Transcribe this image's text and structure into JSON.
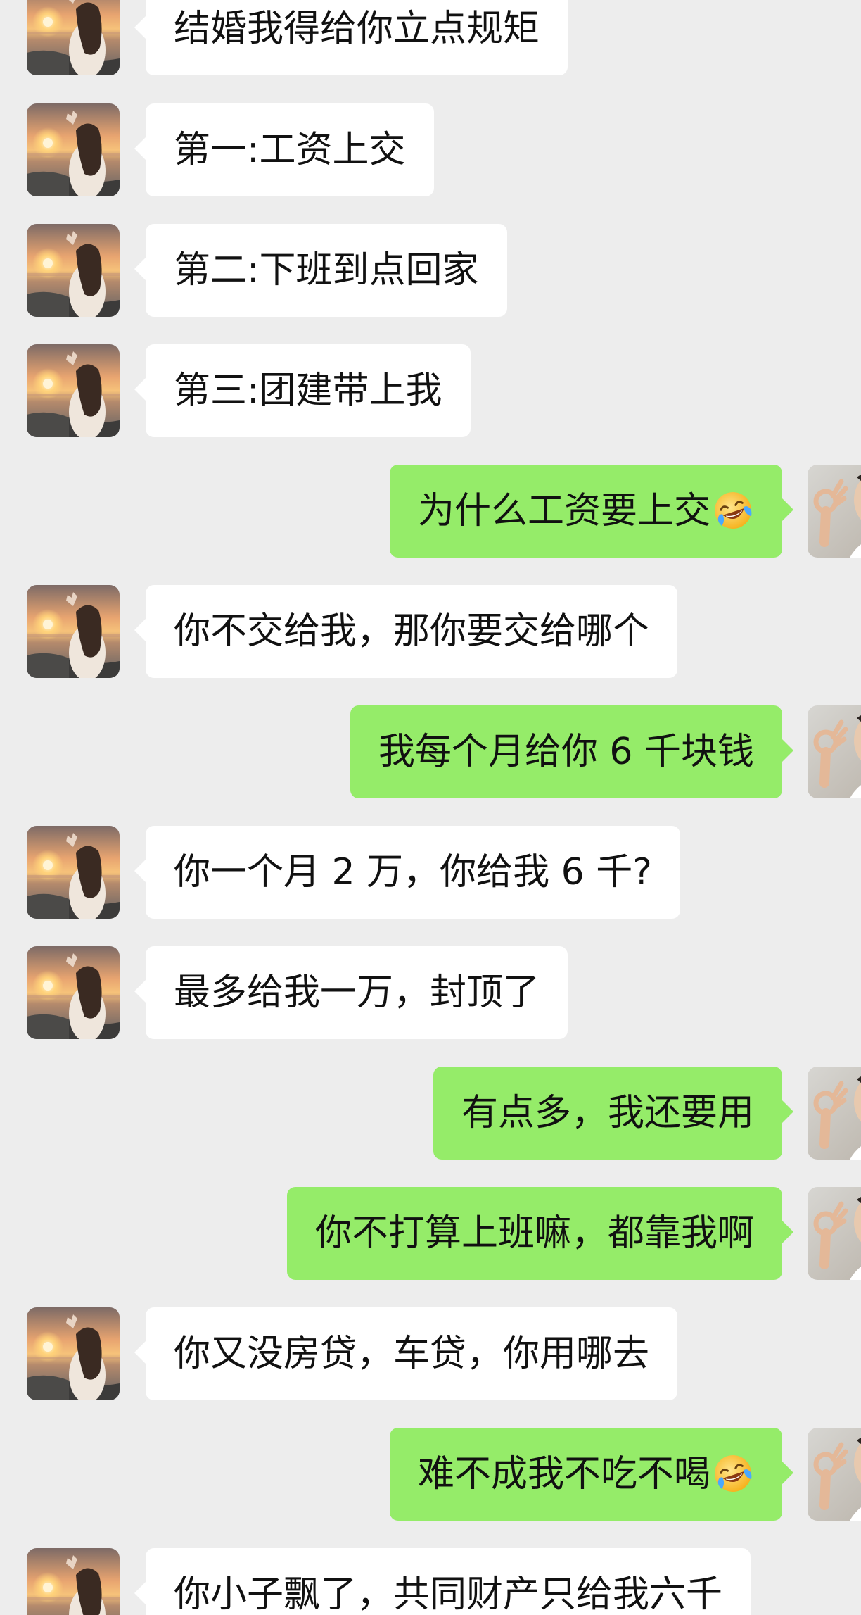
{
  "conversation": {
    "messages": [
      {
        "side": "in",
        "text": "结婚我得给你立点规矩"
      },
      {
        "side": "in",
        "text": "第一:工资上交"
      },
      {
        "side": "in",
        "text": "第二:下班到点回家"
      },
      {
        "side": "in",
        "text": "第三:团建带上我"
      },
      {
        "side": "out",
        "text": "为什么工资要上交",
        "emoji": "laughing-crying-emoji"
      },
      {
        "side": "in",
        "text": "你不交给我，那你要交给哪个"
      },
      {
        "side": "out",
        "text": "我每个月给你 6 千块钱"
      },
      {
        "side": "in",
        "text": "你一个月 2 万，你给我 6 千?"
      },
      {
        "side": "in",
        "text": "最多给我一万，封顶了"
      },
      {
        "side": "out",
        "text": "有点多，我还要用"
      },
      {
        "side": "out",
        "text": "你不打算上班嘛，都靠我啊"
      },
      {
        "side": "in",
        "text": "你又没房贷，车贷，你用哪去"
      },
      {
        "side": "out",
        "text": "难不成我不吃不喝",
        "emoji": "laughing-crying-emoji"
      },
      {
        "side": "in",
        "text": "你小子飘了，共同财产只给我六千"
      }
    ]
  },
  "theme": {
    "background": "#ededed",
    "incoming_bubble": "#ffffff",
    "outgoing_bubble": "#95ec69",
    "text": "#111111"
  },
  "avatars": {
    "contact": "sunset-girl-avatar",
    "self": "man-ok-gesture-avatar"
  }
}
